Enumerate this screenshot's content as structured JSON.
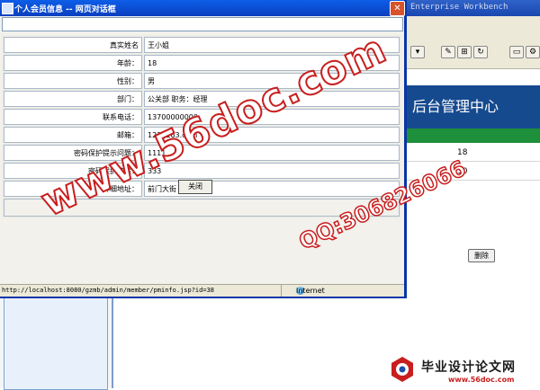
{
  "background_app": {
    "title": "Enterprise Workbench",
    "header_title": "后台管理中心",
    "rows": [
      "18",
      "30"
    ],
    "delete_label": "删除"
  },
  "dialog": {
    "title": "个人会员信息 -- 网页对话框",
    "fields": [
      {
        "label": "真实姓名",
        "value": "王小姐"
      },
      {
        "label": "年龄：",
        "value": "18"
      },
      {
        "label": "性别：",
        "value": "男"
      },
      {
        "label": "部门：",
        "value": "公关部  职务：经理"
      },
      {
        "label": "联系电话：",
        "value": "13700000000"
      },
      {
        "label": "邮箱：",
        "value": "1230163.com"
      },
      {
        "label": "密码保护提示问题：",
        "value": "1111"
      },
      {
        "label": "密码保护答案：",
        "value": "333"
      },
      {
        "label": "详细地址：",
        "value": "前门大街"
      }
    ],
    "close_button_label": "关闭"
  },
  "status_bar": {
    "url": "http://localhost:8080/gzmb/admin/member/pminfo.jsp?id=38",
    "zone": "Internet"
  },
  "watermark": {
    "main": "www.56doc.com",
    "qq": "QQ:306826066",
    "logo_text": "毕业设计论文网",
    "logo_url": "www.56doc.com"
  }
}
